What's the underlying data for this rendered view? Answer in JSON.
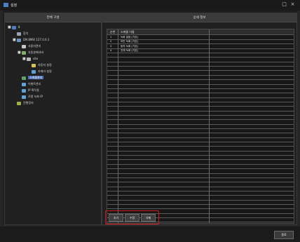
{
  "window": {
    "title": "설정"
  },
  "left_panel": {
    "header": "전체 구성",
    "tree": [
      {
        "label": "8",
        "level": 0,
        "expander": "■",
        "icon_color": "#4a7fc0",
        "selected": false
      },
      {
        "label": "장치",
        "level": 1,
        "expander": "",
        "icon_color": "#9aa3ad",
        "selected": false
      },
      {
        "label": "DN 8MEI 127.0.0.1",
        "level": 1,
        "expander": "■",
        "icon_color": "#6b8fbf",
        "selected": false
      },
      {
        "label": "사용자관리",
        "level": 2,
        "expander": "",
        "icon_color": "#c7c7c7",
        "selected": false
      },
      {
        "label": "자동분배서버",
        "level": 2,
        "expander": "■",
        "icon_color": "#7fb06a",
        "selected": false
      },
      {
        "label": "site",
        "level": 3,
        "expander": "■",
        "icon_color": "#b6b6b6",
        "selected": false
      },
      {
        "label": "자동저 설정",
        "level": 4,
        "expander": "",
        "icon_color": "#d9c24a",
        "selected": false
      },
      {
        "label": "카메라 설정",
        "level": 4,
        "expander": "",
        "icon_color": "#5fa2d6",
        "selected": false
      },
      {
        "label": "스케줄관리",
        "level": 2,
        "expander": "",
        "icon_color": "#5ea06b",
        "selected": true
      },
      {
        "label": "이벤트관리",
        "level": 2,
        "expander": "",
        "icon_color": "#5fa2d6",
        "selected": false
      },
      {
        "label": "IP 확작용",
        "level": 2,
        "expander": "",
        "icon_color": "#5fa2d6",
        "selected": false
      },
      {
        "label": "로컬 녹화 IP",
        "level": 2,
        "expander": "",
        "icon_color": "#5fa2d6",
        "selected": false
      },
      {
        "label": "진행정지",
        "level": 1,
        "expander": "",
        "icon_color": "#9ab04a",
        "selected": false
      }
    ]
  },
  "right_panel": {
    "header": "상세 정보",
    "table": {
      "columns": [
        "순번",
        "스케줄 이름",
        "",
        ""
      ],
      "rows": [
        [
          "1",
          "녹화 없음 [기본]",
          "",
          ""
        ],
        [
          "2",
          "모든 녹화 [기본]",
          "",
          ""
        ],
        [
          "3",
          "동작 녹화 [기본]",
          "",
          ""
        ],
        [
          "4",
          "전체 녹화 [기본]",
          "",
          ""
        ]
      ],
      "empty_rows": 39
    },
    "buttons": {
      "add": "추가",
      "edit": "수정",
      "delete": "삭제"
    }
  },
  "footer": {
    "close": "종료"
  },
  "colors": {
    "accent_selected": "#4b6fb3",
    "highlight_box": "#d11b1b"
  }
}
